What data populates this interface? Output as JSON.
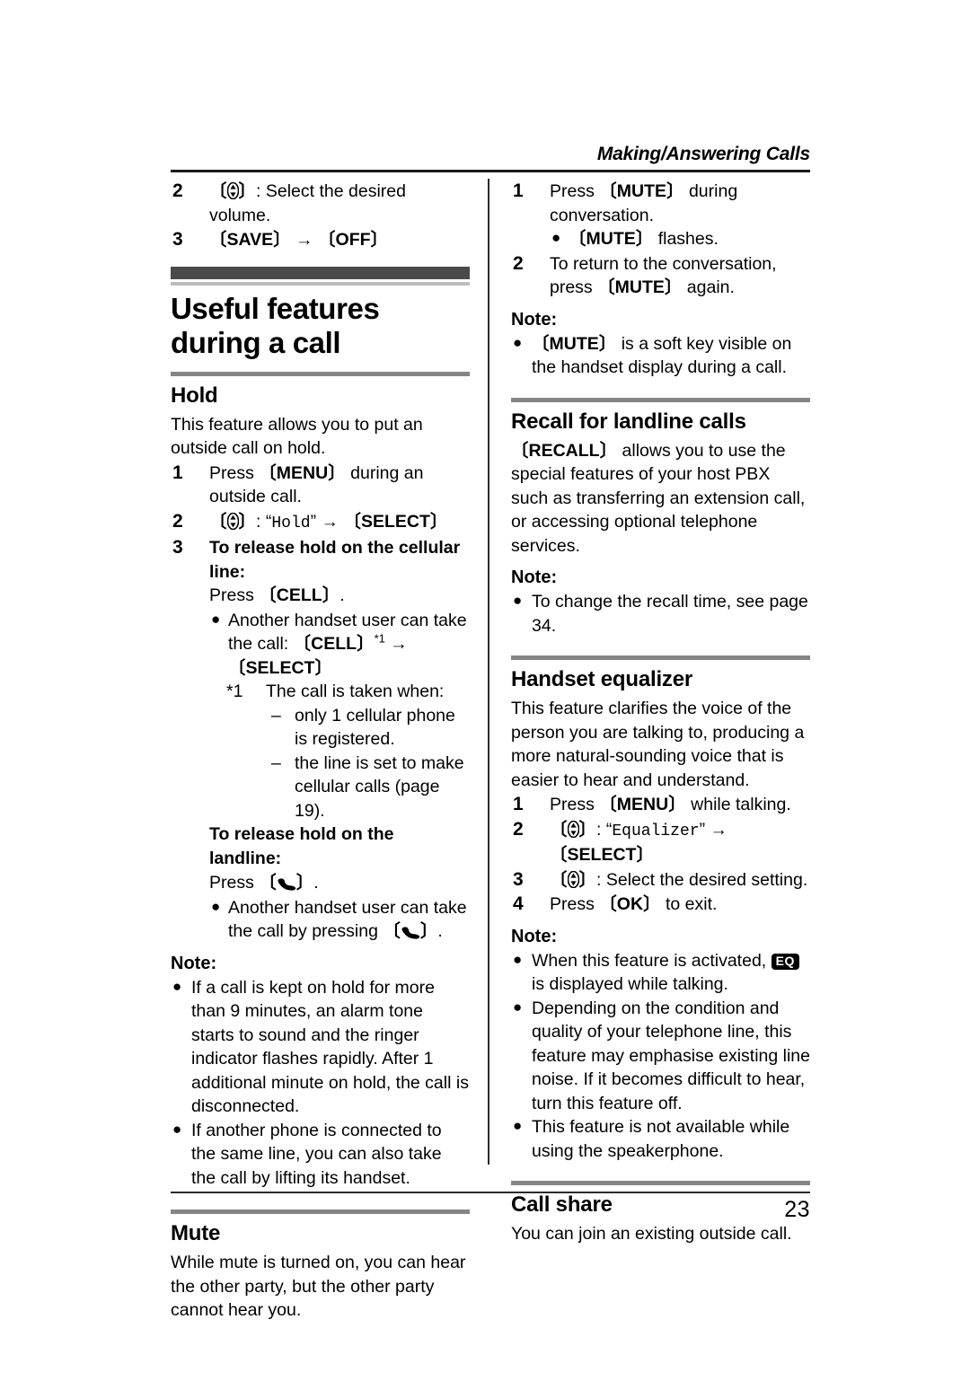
{
  "header": {
    "running_title": "Making/Answering Calls"
  },
  "footer": {
    "page_number": "23"
  },
  "left_column": {
    "volume_steps": [
      {
        "num": "2",
        "prefix_glyph": "navigator-key",
        "text": ": Select the desired volume."
      },
      {
        "num": "3",
        "key_a": "SAVE",
        "arrow": "→",
        "key_b": "OFF"
      }
    ],
    "chapter_title": "Useful features during a call",
    "hold": {
      "title": "Hold",
      "intro": "This feature allows you to put an outside call on hold.",
      "step1": {
        "num": "1",
        "pre": "Press ",
        "key": "MENU",
        "post": " during an outside call."
      },
      "step2": {
        "num": "2",
        "quoted": "Hold",
        "arrow": "→",
        "key": "SELECT"
      },
      "step3": {
        "num": "3",
        "heading": "To release hold on the cellular line:",
        "press_pre": "Press ",
        "press_key": "CELL",
        "press_post": ".",
        "bullet_pre": "Another handset user can take the call: ",
        "bullet_key": "CELL",
        "bullet_sup": "*1",
        "bullet_arrow": "→",
        "bullet_key2": "SELECT",
        "footnote_mark": "*1",
        "footnote_text": "The call is taken when:",
        "footnote_items": [
          "only 1 cellular phone is registered.",
          "the line is set to make cellular calls (page 19)."
        ],
        "landline_heading": "To release hold on the landline:",
        "landline_press_pre": "Press ",
        "landline_press_post": ".",
        "landline_bullet_pre": "Another handset user can take the call by pressing ",
        "landline_bullet_post": "."
      },
      "note_label": "Note:",
      "notes": [
        "If a call is kept on hold for more than 9 minutes, an alarm tone starts to sound and the ringer indicator flashes rapidly. After 1 additional minute on hold, the call is disconnected.",
        "If another phone is connected to the same line, you can also take the call by lifting its handset."
      ]
    },
    "mute": {
      "title": "Mute",
      "body": "While mute is turned on, you can hear the other party, but the other party cannot hear you."
    }
  },
  "right_column": {
    "mute_steps": {
      "step1": {
        "num": "1",
        "pre": "Press ",
        "key": "MUTE",
        "post": " during conversation."
      },
      "step1_bullet": {
        "key": "MUTE",
        "post": " flashes."
      },
      "step2": {
        "num": "2",
        "pre": "To return to the conversation, press ",
        "key": "MUTE",
        "post": " again."
      }
    },
    "mute_note_label": "Note:",
    "mute_note": {
      "key": "MUTE",
      "post": " is a soft key visible on the handset display during a call."
    },
    "recall": {
      "title": "Recall for landline calls",
      "key": "RECALL",
      "body": " allows you to use the special features of your host PBX such as transferring an extension call, or accessing optional telephone services.",
      "note_label": "Note:",
      "note": "To change the recall time, see page 34."
    },
    "equalizer": {
      "title": "Handset equalizer",
      "intro": "This feature clarifies the voice of the person you are talking to, producing a more natural-sounding voice that is easier to hear and understand.",
      "step1": {
        "num": "1",
        "pre": "Press ",
        "key": "MENU",
        "post": " while talking."
      },
      "step2": {
        "num": "2",
        "quoted": "Equalizer",
        "arrow": "→",
        "key": "SELECT"
      },
      "step3": {
        "num": "3",
        "text": ": Select the desired setting."
      },
      "step4": {
        "num": "4",
        "pre": "Press ",
        "key": "OK",
        "post": " to exit."
      },
      "note_label": "Note:",
      "note1_pre": "When this feature is activated, ",
      "note1_badge": "EQ",
      "note1_post": " is displayed while talking.",
      "note2": "Depending on the condition and quality of your telephone line, this feature may emphasise existing line noise. If it becomes difficult to hear, turn this feature off.",
      "note3": "This feature is not available while using the speakerphone."
    },
    "call_share": {
      "title": "Call share",
      "body": "You can join an existing outside call."
    }
  },
  "glyphs": {
    "navigator_key": "navigator-up-down-key",
    "talk_key": "talk-handset-key",
    "bullet": "●",
    "dash": "–",
    "bracket_open": "〔",
    "bracket_close": "〕"
  }
}
